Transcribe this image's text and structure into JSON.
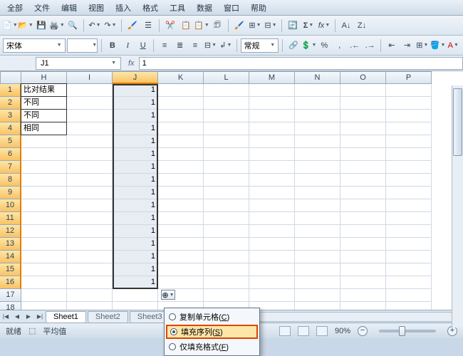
{
  "menubar": {
    "items": [
      "全部",
      "文件",
      "编辑",
      "视图",
      "插入",
      "格式",
      "工具",
      "数据",
      "窗口",
      "帮助"
    ]
  },
  "toolbar2": {
    "font": "宋体",
    "size": "",
    "normal_label": "常规",
    "bold": "B",
    "italic": "I",
    "underline": "U"
  },
  "namebox": {
    "ref": "J1"
  },
  "formula": {
    "fx": "fx",
    "value": "1"
  },
  "sheet": {
    "columns": [
      "H",
      "I",
      "J",
      "K",
      "L",
      "M",
      "N",
      "O",
      "P"
    ],
    "selected_col_idx": 2,
    "row_count": 18,
    "selected_rows_from": 1,
    "selected_rows_to": 16,
    "h_cells": [
      "比对结果",
      "不同",
      "不同",
      "相同"
    ],
    "j_value": "1",
    "selection_from_row": 1,
    "selection_to_row": 16
  },
  "autofill": {
    "options": [
      {
        "label_pre": "复制单元格(",
        "hotkey": "C",
        "label_post": ")",
        "checked": false
      },
      {
        "label_pre": "填充序列(",
        "hotkey": "S",
        "label_post": ")",
        "checked": true
      },
      {
        "label_pre": "仅填充格式(",
        "hotkey": "F",
        "label_post": ")",
        "checked": false
      }
    ]
  },
  "tabs": {
    "nav": [
      "|◀",
      "◀",
      "▶",
      "▶|"
    ],
    "sheets": [
      "Sheet1",
      "Sheet2",
      "Sheet3"
    ],
    "active": 0
  },
  "status": {
    "ready": "就绪",
    "avg_label": "平均值",
    "zoom": "90%"
  }
}
